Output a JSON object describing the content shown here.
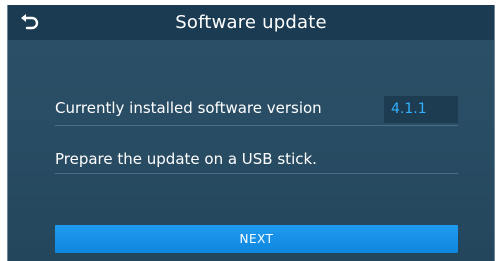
{
  "header": {
    "title": "Software update",
    "back_icon": "back-arrow-icon"
  },
  "content": {
    "version_label": "Currently installed software version",
    "version_value": "4.1.1",
    "prepare_text": "Prepare the update on a USB stick."
  },
  "actions": {
    "next_label": "NEXT"
  },
  "colors": {
    "background": "#2a4e66",
    "header": "#1b3b52",
    "accent": "#1593e8",
    "value_text": "#33b1ff"
  }
}
